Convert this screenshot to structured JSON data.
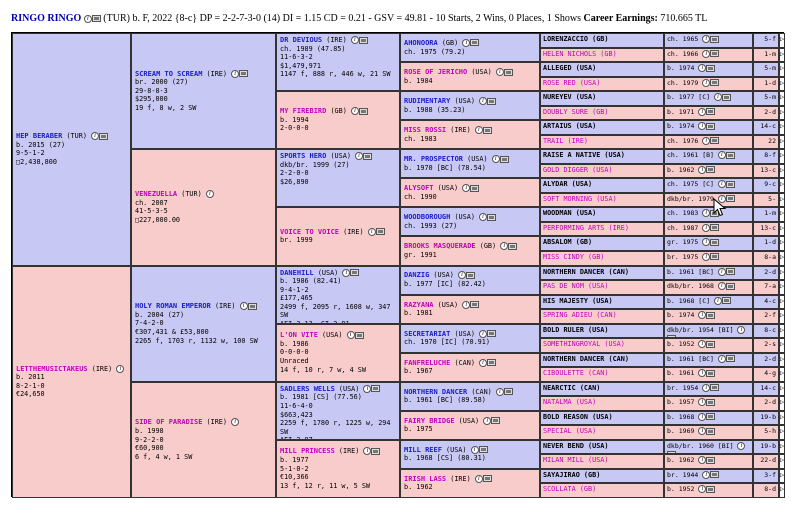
{
  "header": {
    "horse_name": "RINGO RINGO",
    "summary": "(TUR) b. F, 2022 {8-c} DP = 2-2-7-3-0 (14) DI = 1.15   CD = 0.21 - GSV = 49.81 - 10 Starts, 2 Wins, 0 Places, 1 Shows",
    "earnings_label": "Career Earnings:",
    "earnings_value": "710.665 TL"
  },
  "gen1": [
    {
      "name": "HEP BERABER",
      "country": "(TUR)",
      "l1": "b. 2015 (27)",
      "l2": "9-5-1-2",
      "l3": "□2,438,800"
    },
    {
      "name": "LETTHEMUSICTAKEUS",
      "country": "(IRE)",
      "l1": "b. 2011",
      "l2": "8-2-1-0",
      "l3": "€24,650"
    }
  ],
  "gen2": [
    {
      "name": "SCREAM TO SCREAM",
      "country": "(IRE)",
      "l1": "br. 2000 (27)",
      "l2": "29-8-8-3",
      "l3": "$295,000",
      "l4": "19 f, 8 w, 2 SW"
    },
    {
      "name": "VENEZUELLA",
      "country": "(TUR)",
      "l1": "ch. 2007",
      "l2": "41-5-3-5",
      "l3": "□227,000.00",
      "l4": ""
    },
    {
      "name": "HOLY ROMAN EMPEROR",
      "country": "(IRE)",
      "l1": "b. 2004 (27)",
      "l2": "7-4-2-0",
      "l3": "€307,431 & £53,800",
      "l4": "2265 f, 1703 r, 1132 w, 100 SW"
    },
    {
      "name": "SIDE OF PARADISE",
      "country": "(IRE)",
      "l1": "b. 1998",
      "l2": "9-2-2-0",
      "l3": "€60,900",
      "l4": "6 f, 4 w, 1 SW"
    }
  ],
  "gen3": [
    {
      "name": "DR DEVIOUS",
      "country": "(IRE)",
      "l1": "ch. 1989 (47.85)",
      "l2": "11-6-3-2",
      "l3": "$1,479,971",
      "l4": "1147 f, 888 r, 446 w, 21 SW"
    },
    {
      "name": "MY FIREBIRD",
      "country": "(GB)",
      "l1": "b. 1994",
      "l2": "2-0-0-0",
      "l3": "",
      "l4": ""
    },
    {
      "name": "SPORTS HERO",
      "country": "(USA)",
      "l1": "dkb/br. 1999 (27)",
      "l2": "2-2-0-0",
      "l3": "$26,890",
      "l4": ""
    },
    {
      "name": "VOICE TO VOICE",
      "country": "(IRE)",
      "l1": "br. 1999",
      "l2": "",
      "l3": "",
      "l4": ""
    },
    {
      "name": "DANEHILL",
      "country": "(USA)",
      "l1": "b. 1986 (82.41)",
      "l2": "9-4-1-2",
      "l3": "£177,465",
      "l4": "2499 f, 2095 r, 1608 w, 347 SW",
      "l5": "AEI 3.13, CI 2.01"
    },
    {
      "name": "L'ON VITE",
      "country": "(USA)",
      "l1": "b. 1986",
      "l2": "0-0-0-0",
      "l3": "Unraced",
      "l4": "14 f, 10 r, 7 w, 4 SW",
      "l5": ""
    },
    {
      "name": "SADLERS WELLS",
      "country": "(USA)",
      "l1": "b. 1981 [CS] (77.56)",
      "l2": "11-6-4-0",
      "l3": "$663,423",
      "l4": "2259 f, 1780 r, 1225 w, 294 SW",
      "l5": "AEI 2.97"
    },
    {
      "name": "MILL PRINCESS",
      "country": "(IRE)",
      "l1": "b. 1977",
      "l2": "5-1-0-2",
      "l3": "€10,366",
      "l4": "13 f, 12 r, 11 w, 5 SW",
      "l5": ""
    }
  ],
  "gen4": [
    {
      "name": "AHONOORA",
      "country": "(GB)",
      "l1": "ch. 1975 (79.2)"
    },
    {
      "name": "ROSE OF JERICHO",
      "country": "(USA)",
      "l1": "b. 1984"
    },
    {
      "name": "RUDIMENTARY",
      "country": "(USA)",
      "l1": "b. 1988 (35.23)"
    },
    {
      "name": "MISS ROSSI",
      "country": "(IRE)",
      "l1": "ch. 1983"
    },
    {
      "name": "MR. PROSPECTOR",
      "country": "(USA)",
      "l1": "b. 1970 [BC] (78.54)"
    },
    {
      "name": "ALYSOFT",
      "country": "(USA)",
      "l1": "ch. 1990"
    },
    {
      "name": "WOODBOROUGH",
      "country": "(USA)",
      "l1": "ch. 1993 (27)"
    },
    {
      "name": "BROOKS MASQUERADE",
      "country": "(GB)",
      "l1": "gr. 1991"
    },
    {
      "name": "DANZIG",
      "country": "(USA)",
      "l1": "b. 1977 [IC] (82.42)"
    },
    {
      "name": "RAZYANA",
      "country": "(USA)",
      "l1": "b. 1981"
    },
    {
      "name": "SECRETARIAT",
      "country": "(USA)",
      "l1": "ch. 1970 [IC] (70.91)"
    },
    {
      "name": "FANFRELUCHE",
      "country": "(CAN)",
      "l1": "b. 1967"
    },
    {
      "name": "NORTHERN DANCER",
      "country": "(CAN)",
      "l1": "b. 1961 [BC] (89.58)"
    },
    {
      "name": "FAIRY BRIDGE",
      "country": "(USA)",
      "l1": "b. 1975"
    },
    {
      "name": "MILL REEF",
      "country": "(USA)",
      "l1": "b. 1968 [CS] (80.31)"
    },
    {
      "name": "IRISH LASS",
      "country": "(IRE)",
      "l1": "b. 1962"
    }
  ],
  "gen5": [
    {
      "name": "LORENZACCIO (GB)",
      "info": "ch. 1965",
      "num": "5-f"
    },
    {
      "name": "HELEN NICHOLS (GB)",
      "info": "ch. 1966",
      "num": "1-m"
    },
    {
      "name": "ALLEGED (USA)",
      "info": "b. 1974",
      "num": "5-m"
    },
    {
      "name": "ROSE RED (USA)",
      "info": "ch. 1979",
      "num": "1-d"
    },
    {
      "name": "NUREYEV (USA)",
      "info": "b. 1977 [C]",
      "num": "5-m"
    },
    {
      "name": "DOUBLY SURE (GB)",
      "info": "b. 1971",
      "num": "2-d"
    },
    {
      "name": "ARTAIUS (USA)",
      "info": "b. 1974",
      "num": "14-c"
    },
    {
      "name": "TRAIL (IRE)",
      "info": "ch. 1976",
      "num": "22"
    },
    {
      "name": "RAISE A NATIVE (USA)",
      "info": "ch. 1961 [B]",
      "num": "8-f"
    },
    {
      "name": "GOLD DIGGER (USA)",
      "info": "b. 1962",
      "num": "13-c"
    },
    {
      "name": "ALYDAR (USA)",
      "info": "ch. 1975 [C]",
      "num": "9-c"
    },
    {
      "name": "SOFT MORNING (USA)",
      "info": "dkb/br. 1979",
      "num": "5-"
    },
    {
      "name": "WOODMAN (USA)",
      "info": "ch. 1983",
      "num": "1-m"
    },
    {
      "name": "PERFORMING ARTS (IRE)",
      "info": "ch. 1987",
      "num": "13-c"
    },
    {
      "name": "ABSALOM (GB)",
      "info": "gr. 1975",
      "num": "1-d"
    },
    {
      "name": "MISS CINDY (GB)",
      "info": "br. 1975",
      "num": "8-a"
    },
    {
      "name": "NORTHERN DANCER (CAN)",
      "info": "b. 1961 [BC]",
      "num": "2-d"
    },
    {
      "name": "PAS DE NOM (USA)",
      "info": "dkb/br. 1968",
      "num": "7-a"
    },
    {
      "name": "HIS MAJESTY (USA)",
      "info": "b. 1968 [C]",
      "num": "4-c"
    },
    {
      "name": "SPRING ADIEU (CAN)",
      "info": "b. 1974",
      "num": "2-f"
    },
    {
      "name": "BOLD RULER (USA)",
      "info": "dkb/br. 1954 [BI]",
      "num": "8-c"
    },
    {
      "name": "SOMETHINGROYAL (USA)",
      "info": "b. 1952",
      "num": "2-s"
    },
    {
      "name": "NORTHERN DANCER (CAN)",
      "info": "b. 1961 [BC]",
      "num": "2-d"
    },
    {
      "name": "CIBOULETTE (CAN)",
      "info": "b. 1961",
      "num": "4-g"
    },
    {
      "name": "NEARCTIC (CAN)",
      "info": "br. 1954",
      "num": "14-c"
    },
    {
      "name": "NATALMA (USA)",
      "info": "b. 1957",
      "num": "2-d"
    },
    {
      "name": "BOLD REASON (USA)",
      "info": "b. 1968",
      "num": "19-b"
    },
    {
      "name": "SPECIAL (USA)",
      "info": "b. 1969",
      "num": "5-h"
    },
    {
      "name": "NEVER BEND (USA)",
      "info": "dkb/br. 1960 [BI]",
      "num": "19-b"
    },
    {
      "name": "MILAN MILL (USA)",
      "info": "b. 1962",
      "num": "22-d"
    },
    {
      "name": "SAYAJIRAO (GB)",
      "info": "br. 1944",
      "num": "3-f"
    },
    {
      "name": "SCOLLATA (GB)",
      "info": "b. 1952",
      "num": "8-d"
    }
  ]
}
